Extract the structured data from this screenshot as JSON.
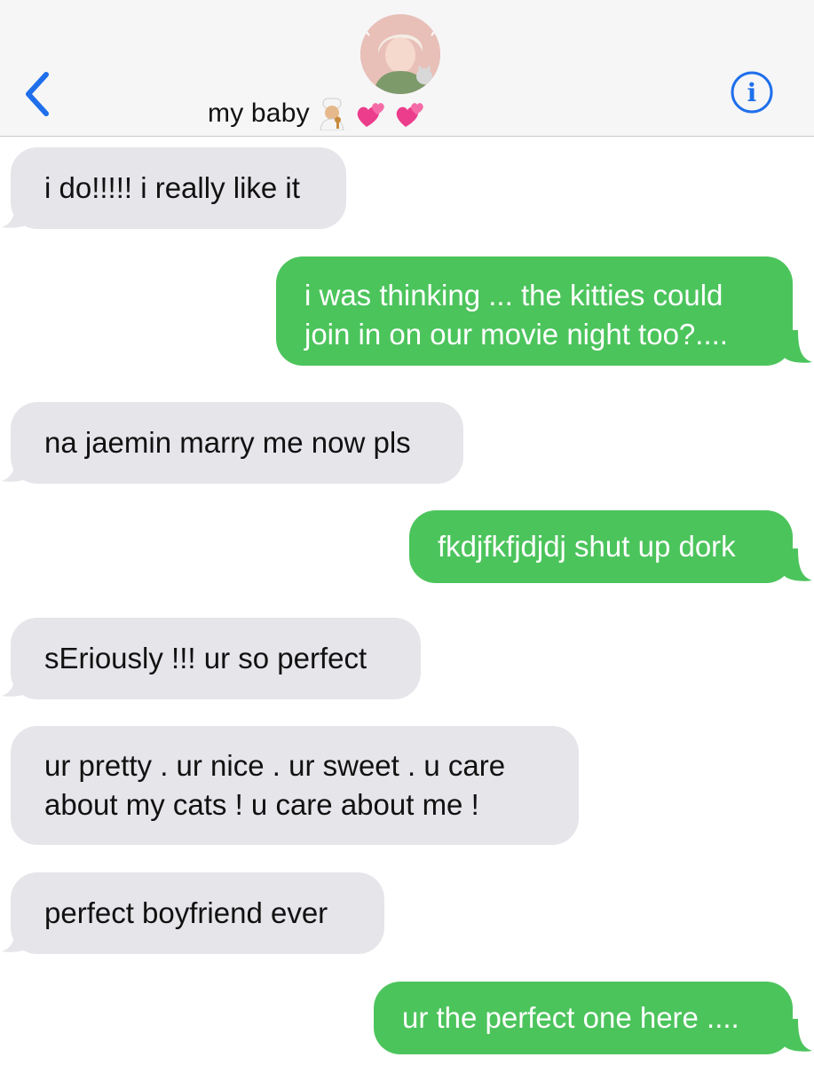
{
  "header": {
    "contact_name": "my baby",
    "name_emojis": [
      "cook-emoji",
      "two-hearts-emoji",
      "two-hearts-emoji"
    ]
  },
  "colors": {
    "incoming_bubble": "#e5e5ea",
    "outgoing_bubble": "#4cc45c",
    "accent": "#1f6feb",
    "header_bg": "#f6f6f7"
  },
  "messages": [
    {
      "direction": "incoming",
      "lines": [
        "i do!!!!! i really like it"
      ]
    },
    {
      "direction": "outgoing",
      "lines": [
        "i was thinking ... the kitties could",
        "join in on our movie night too?...."
      ]
    },
    {
      "direction": "incoming",
      "lines": [
        "na jaemin marry me now pls"
      ]
    },
    {
      "direction": "outgoing",
      "lines": [
        "fkdjfkfjdjdj shut up dork"
      ]
    },
    {
      "direction": "incoming",
      "lines": [
        "sEriously !!! ur so perfect"
      ]
    },
    {
      "direction": "incoming",
      "lines": [
        "ur pretty . ur nice . ur sweet . u care",
        "about my cats ! u care about me !"
      ]
    },
    {
      "direction": "incoming",
      "lines": [
        "perfect boyfriend ever"
      ]
    },
    {
      "direction": "outgoing",
      "lines": [
        "ur the perfect one here ...."
      ]
    }
  ]
}
